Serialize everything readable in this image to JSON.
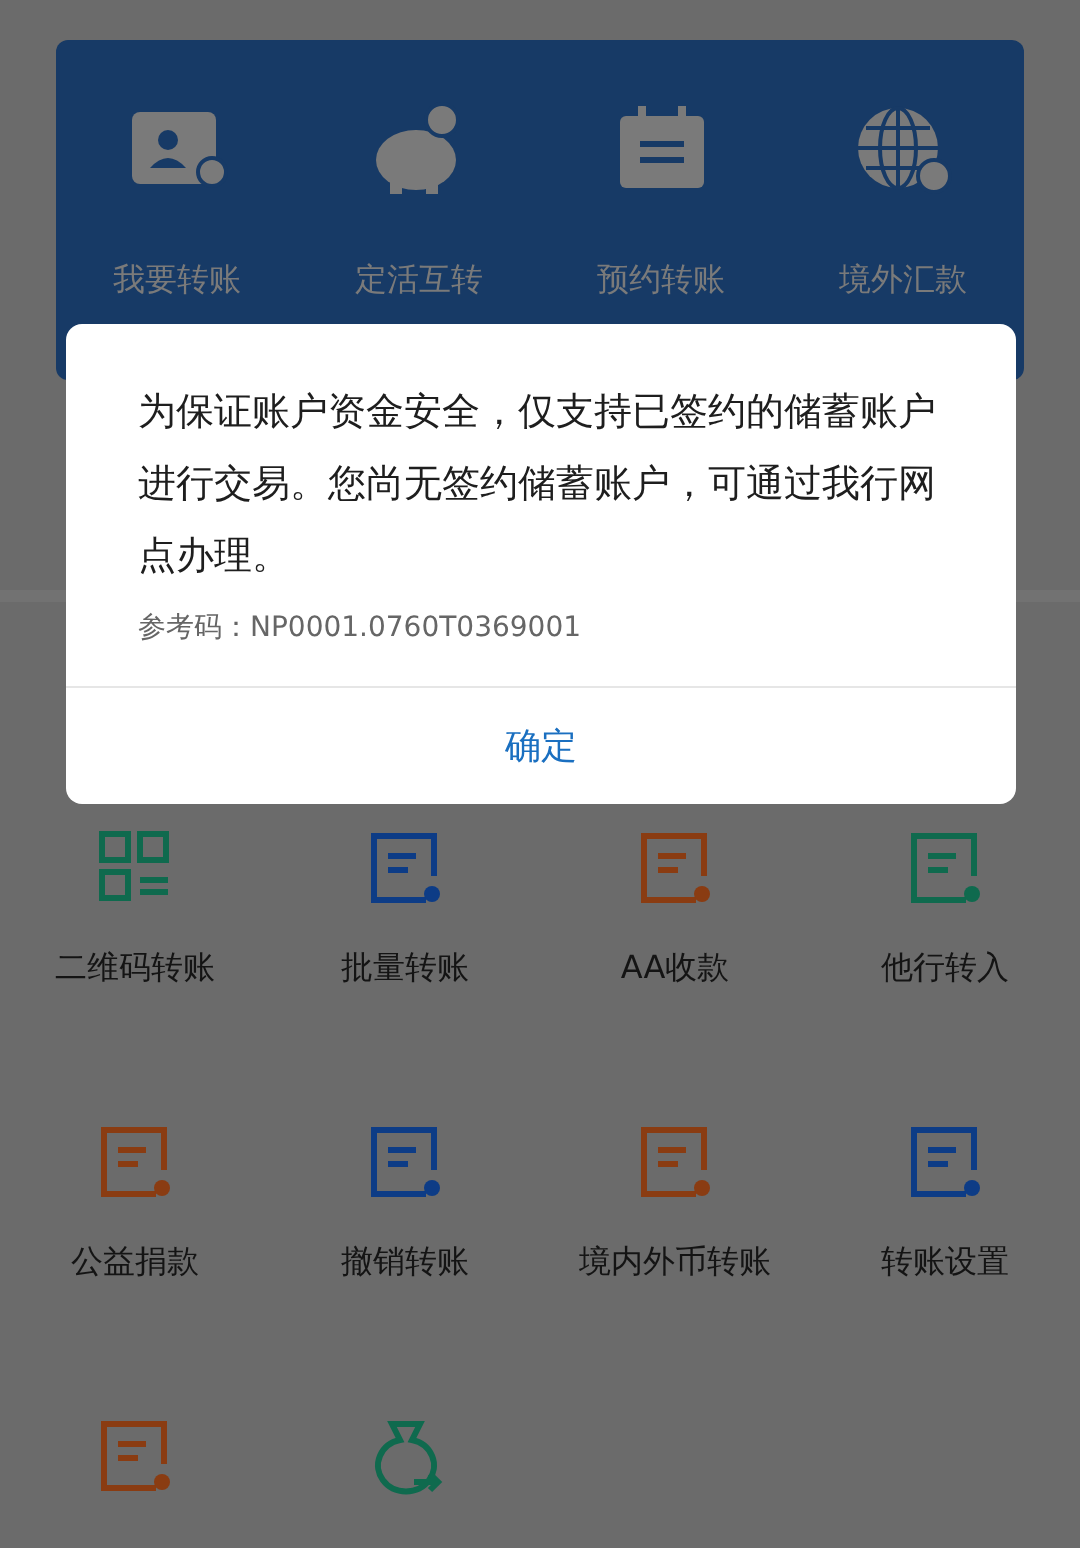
{
  "top_card": {
    "items": [
      {
        "label": "我要转账"
      },
      {
        "label": "定活互转"
      },
      {
        "label": "预约转账"
      },
      {
        "label": "境外汇款"
      }
    ]
  },
  "services": [
    {
      "label": "二维码转账",
      "color": "#0f6a4e"
    },
    {
      "label": "批量转账",
      "color": "#0d3c86"
    },
    {
      "label": "AA收款",
      "color": "#8a3c12"
    },
    {
      "label": "他行转入",
      "color": "#0f6a4e"
    },
    {
      "label": "公益捐款",
      "color": "#8a3c12"
    },
    {
      "label": "撤销转账",
      "color": "#0d3c86"
    },
    {
      "label": "境内外币转账",
      "color": "#8a3c12"
    },
    {
      "label": "转账设置",
      "color": "#0d3c86"
    },
    {
      "color": "#8a3c12"
    },
    {
      "color": "#0f6a4e"
    }
  ],
  "dialog": {
    "message": "为保证账户资金安全，仅支持已签约的储蓄账户进行交易。您尚无签约储蓄账户，可通过我行网点办理。",
    "reference": "参考码：NP0001.0760T0369001",
    "confirm": "确定"
  }
}
